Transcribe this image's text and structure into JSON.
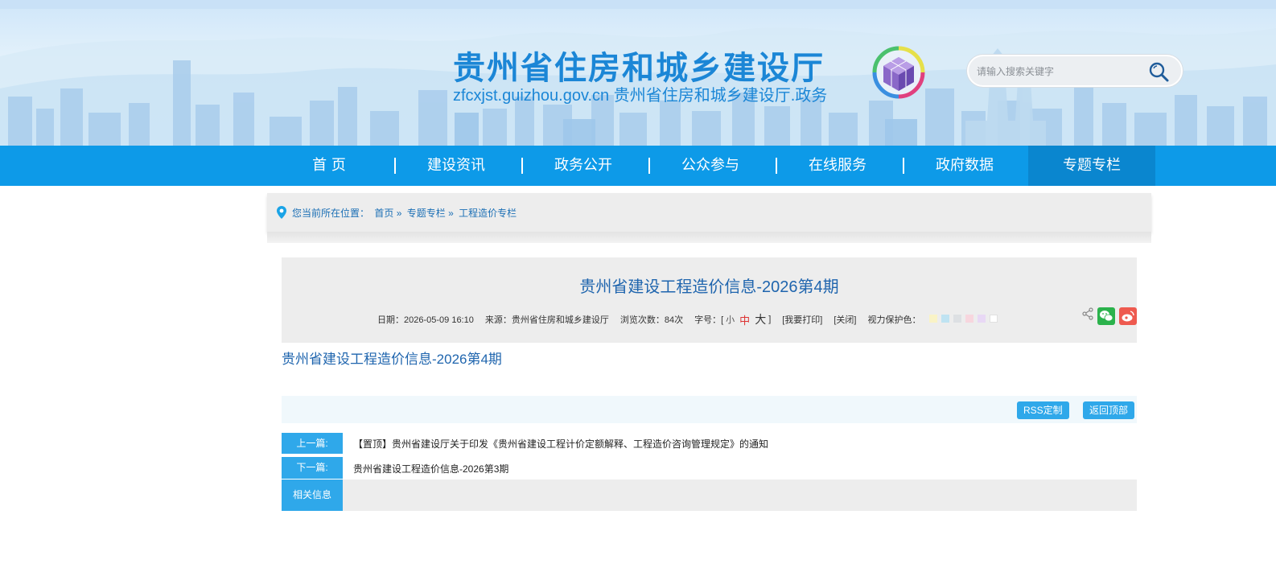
{
  "header": {
    "title": "贵州省住房和城乡建设厅",
    "subtitle": "zfcxjst.guizhou.gov.cn 贵州省住房和城乡建设厅.政务",
    "search_placeholder": "请输入搜索关键字"
  },
  "nav": {
    "items": [
      {
        "label": "首  页"
      },
      {
        "label": "建设资讯"
      },
      {
        "label": "政务公开"
      },
      {
        "label": "公众参与"
      },
      {
        "label": "在线服务"
      },
      {
        "label": "政府数据"
      },
      {
        "label": "专题专栏"
      }
    ],
    "active_index": 6
  },
  "breadcrumb": {
    "prefix": "您当前所在位置：",
    "items": [
      "首页",
      "专题专栏",
      "工程造价专栏"
    ],
    "separator": "»"
  },
  "article": {
    "title": "贵州省建设工程造价信息-2026第4期",
    "date": "日期：2026-05-09 16:10",
    "source": "来源：贵州省住房和城乡建设厅",
    "views": "浏览次数：84次",
    "font_label": "字号：[",
    "font_small": "小",
    "font_medium": "中",
    "font_large": "大",
    "font_close": "]",
    "print": "[我要打印]",
    "close": "[关闭]",
    "eye_label": "视力保护色：",
    "eye_colors": [
      "#f9f3c6",
      "#bfe3f2",
      "#dde0e3",
      "#f7d6de",
      "#e8d8f5",
      "#ffffff"
    ],
    "body_title": "贵州省建设工程造价信息-2026第4期"
  },
  "toolbar": {
    "rss": "RSS定制",
    "top": "返回顶部"
  },
  "links": {
    "prev_label": "上一篇:",
    "prev_title": "【置顶】贵州省建设厅关于印发《贵州省建设工程计价定额解释、工程造价咨询管理规定》的通知",
    "next_label": "下一篇:",
    "next_title": "贵州省建设工程造价信息-2026第3期",
    "related_label": "相关信息"
  },
  "colors": {
    "nav_bg": "#0d9ae8",
    "nav_active": "#0a86cf",
    "accent": "#2fa8ea",
    "title": "#1f65ae"
  }
}
